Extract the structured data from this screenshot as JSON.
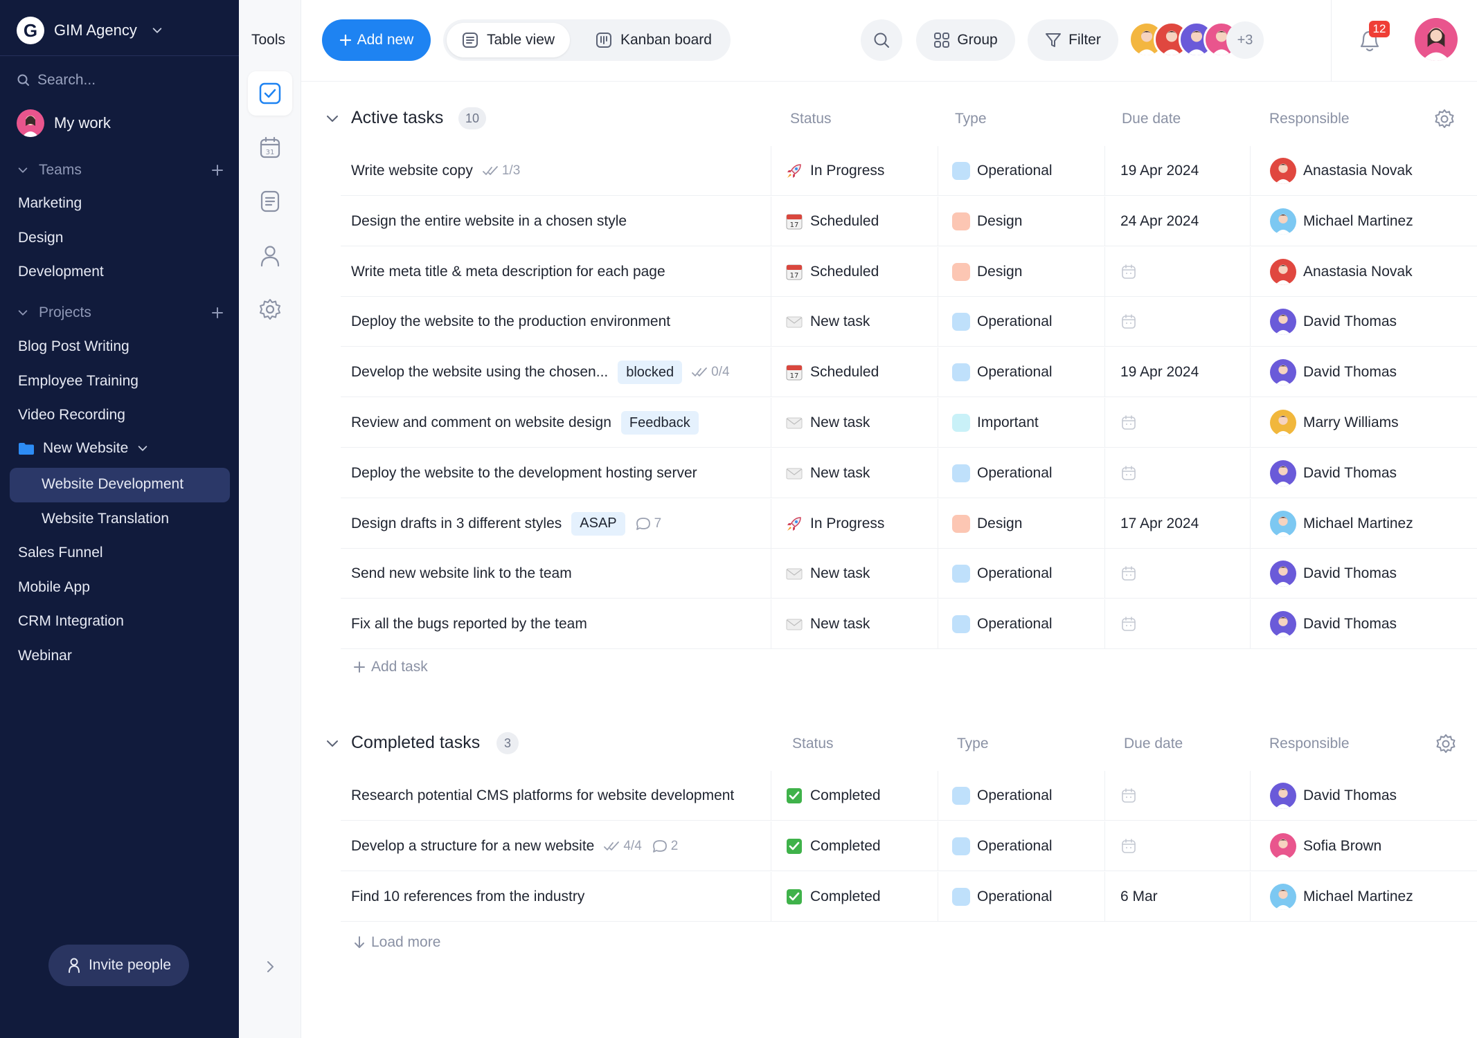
{
  "sidebar": {
    "org_name": "GIM Agency",
    "search_placeholder": "Search...",
    "my_work": "My work",
    "teams_label": "Teams",
    "teams": [
      "Marketing",
      "Design",
      "Development"
    ],
    "projects_label": "Projects",
    "projects_before": [
      "Blog Post Writing",
      "Employee Training",
      "Video Recording"
    ],
    "folder": "New Website",
    "folder_children": [
      "Website Development",
      "Website Translation"
    ],
    "projects_after": [
      "Sales Funnel",
      "Mobile App",
      "CRM Integration",
      "Webinar"
    ],
    "invite": "Invite people"
  },
  "tools": {
    "title": "Tools"
  },
  "topbar": {
    "add_new": "Add new",
    "table_view": "Table view",
    "kanban_board": "Kanban board",
    "group": "Group",
    "filter": "Filter",
    "more_members": "+3",
    "notifications": "12"
  },
  "columns": {
    "status": "Status",
    "type": "Type",
    "due": "Due date",
    "responsible": "Responsible"
  },
  "active": {
    "title": "Active tasks",
    "count": "10",
    "add_task": "Add task",
    "rows": [
      {
        "name": "Write website copy",
        "checklist": "1/3",
        "status": "In Progress",
        "status_icon": "rocket",
        "type": "Operational",
        "due": "19 Apr 2024",
        "resp": "Anastasia Novak"
      },
      {
        "name": "Design the entire website in a chosen style",
        "status": "Scheduled",
        "status_icon": "calendar",
        "type": "Design",
        "due": "24 Apr 2024",
        "resp": "Michael Martinez"
      },
      {
        "name": "Write meta title & meta description for each page",
        "status": "Scheduled",
        "status_icon": "calendar",
        "type": "Design",
        "due": "",
        "resp": "Anastasia Novak"
      },
      {
        "name": "Deploy the website to the production environment",
        "status": "New task",
        "status_icon": "envelope",
        "type": "Operational",
        "due": "",
        "resp": "David Thomas"
      },
      {
        "name": "Develop the website using the chosen...",
        "tag": "blocked",
        "checklist": "0/4",
        "status": "Scheduled",
        "status_icon": "calendar",
        "type": "Operational",
        "due": "19 Apr 2024",
        "resp": "David Thomas"
      },
      {
        "name": "Review and comment on website design",
        "tag": "Feedback",
        "status": "New task",
        "status_icon": "envelope",
        "type": "Important",
        "due": "",
        "resp": "Marry Williams"
      },
      {
        "name": "Deploy the website to the development hosting server",
        "status": "New task",
        "status_icon": "envelope",
        "type": "Operational",
        "due": "",
        "resp": "David Thomas"
      },
      {
        "name": "Design drafts in 3 different styles",
        "tag": "ASAP",
        "comments": "7",
        "status": "In Progress",
        "status_icon": "rocket",
        "type": "Design",
        "due": "17 Apr 2024",
        "resp": "Michael Martinez"
      },
      {
        "name": "Send new website link to the team",
        "status": "New task",
        "status_icon": "envelope",
        "type": "Operational",
        "due": "",
        "resp": "David Thomas"
      },
      {
        "name": "Fix all the bugs reported by the team",
        "status": "New task",
        "status_icon": "envelope",
        "type": "Operational",
        "due": "",
        "resp": "David Thomas"
      }
    ]
  },
  "completed": {
    "title": "Completed tasks",
    "count": "3",
    "load_more": "Load more",
    "rows": [
      {
        "name": "Research potential CMS platforms for website development",
        "status": "Completed",
        "status_icon": "check",
        "type": "Operational",
        "due": "",
        "resp": "David Thomas"
      },
      {
        "name": "Develop a structure for a new website",
        "checklist": "4/4",
        "comments": "2",
        "status": "Completed",
        "status_icon": "check",
        "type": "Operational",
        "due": "",
        "resp": "Sofia Brown"
      },
      {
        "name": "Find 10 references from the industry",
        "status": "Completed",
        "status_icon": "check",
        "type": "Operational",
        "due": "6 Mar",
        "resp": "Michael Martinez"
      }
    ]
  },
  "type_colors": {
    "Operational": "#bfe0fb",
    "Design": "#fcc6b3",
    "Important": "#c9f1f8"
  },
  "person_colors": {
    "Anastasia Novak": "#e0473f",
    "Michael Martinez": "#7cc8f2",
    "David Thomas": "#6a5ad9",
    "Marry Williams": "#f1b73c",
    "Sofia Brown": "#e9558d"
  },
  "team_avatar_colors": [
    "#f3b640",
    "#e0473f",
    "#6a5ad9",
    "#e9558d",
    "#7cc8f2"
  ],
  "accent": "#1e83f2"
}
